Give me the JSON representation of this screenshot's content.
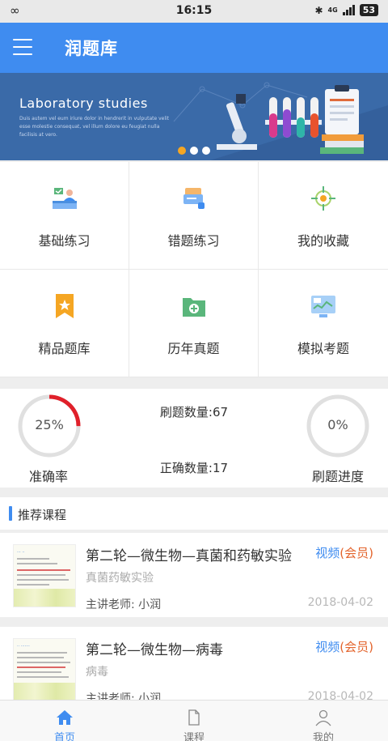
{
  "status_bar": {
    "time": "16:15",
    "battery": "53",
    "network": "4G"
  },
  "app_bar": {
    "title": "润题库",
    "menu_icon": "menu-icon"
  },
  "banner": {
    "title": "Laboratory studies",
    "subtitle": "Duis autem vel eum iriure dolor in hendrerit in vulputate velit esse molestie consequat, vel illum dolore eu feugiat nulla facilisis at vero.",
    "slide_count": 3,
    "active_slide": 1
  },
  "grid": [
    {
      "label": "基础练习",
      "icon": "reception-desk-icon"
    },
    {
      "label": "错题练习",
      "icon": "card-icon"
    },
    {
      "label": "我的收藏",
      "icon": "target-icon"
    },
    {
      "label": "精品题库",
      "icon": "bookmark-star-icon"
    },
    {
      "label": "历年真题",
      "icon": "folder-plus-icon"
    },
    {
      "label": "模拟考题",
      "icon": "monitor-chart-icon"
    }
  ],
  "stats": {
    "accuracy": {
      "value": "25%",
      "label": "准确率",
      "fraction": 0.25
    },
    "count_text": "刷题数量:67",
    "correct_text": "正确数量:17",
    "progress": {
      "value": "0%",
      "label": "刷题进度",
      "fraction": 0
    }
  },
  "section": {
    "title": "推荐课程"
  },
  "courses": [
    {
      "title": "第二轮—微生物—真菌和药敏实验",
      "tag_type": "视频",
      "tag_vip": "(会员)",
      "subtitle": "真菌药敏实验",
      "teacher": "主讲老师:   小润",
      "date": "2018-04-02"
    },
    {
      "title": "第二轮—微生物—病毒",
      "tag_type": "视频",
      "tag_vip": "(会员)",
      "subtitle": "病毒",
      "teacher": "主讲老师:   小润",
      "date": "2018-04-02"
    }
  ],
  "bottom_nav": [
    {
      "label": "首页",
      "icon": "home-icon",
      "active": true
    },
    {
      "label": "课程",
      "icon": "document-icon",
      "active": false
    },
    {
      "label": "我的",
      "icon": "user-icon",
      "active": false
    }
  ],
  "colors": {
    "primary": "#3f8cf0",
    "accent_red": "#e0202a",
    "vip_orange": "#e3632b",
    "dot_active": "#f5a623"
  }
}
